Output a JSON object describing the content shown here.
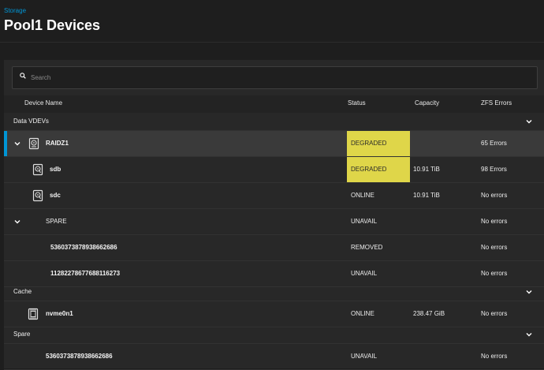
{
  "breadcrumb": "Storage",
  "page_title": "Pool1 Devices",
  "search": {
    "placeholder": "Search"
  },
  "columns": {
    "name": "Device Name",
    "status": "Status",
    "capacity": "Capacity",
    "zfs_errors": "ZFS Errors"
  },
  "groups": {
    "data": "Data VDEVs",
    "cache": "Cache",
    "spare": "Spare"
  },
  "rows": {
    "raidz1": {
      "name": "RAIDZ1",
      "status": "DEGRADED",
      "capacity": "",
      "errors": "65 Errors"
    },
    "sdb": {
      "name": "sdb",
      "status": "DEGRADED",
      "capacity": "10.91 TiB",
      "errors": "98 Errors"
    },
    "sdc": {
      "name": "sdc",
      "status": "ONLINE",
      "capacity": "10.91 TiB",
      "errors": "No errors"
    },
    "spare_vdev": {
      "name": "SPARE",
      "status": "UNAVAIL",
      "capacity": "",
      "errors": "No errors"
    },
    "spare_a": {
      "name": "5360373878938662686",
      "status": "REMOVED",
      "capacity": "",
      "errors": "No errors"
    },
    "spare_b": {
      "name": "11282278677688116273",
      "status": "UNAVAIL",
      "capacity": "",
      "errors": "No errors"
    },
    "nvme": {
      "name": "nvme0n1",
      "status": "ONLINE",
      "capacity": "238.47 GiB",
      "errors": "No errors"
    },
    "spare_c": {
      "name": "5360373878938662686",
      "status": "UNAVAIL",
      "capacity": "",
      "errors": "No errors"
    }
  },
  "colors": {
    "accent": "#0095d5",
    "degraded": "#dfd649",
    "background": "#1e1e1e",
    "card": "#282828",
    "selected_row": "#3a3a3a"
  },
  "icons": {
    "search": "search-icon",
    "hdd": "hard-disk-icon",
    "vdev": "vdev-icon",
    "ssd": "ssd-icon",
    "expand": "chevron-down-icon"
  }
}
